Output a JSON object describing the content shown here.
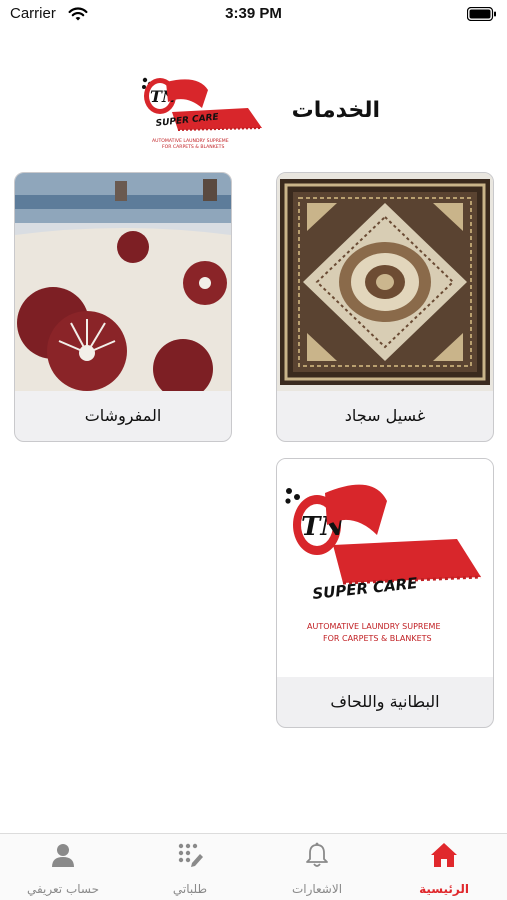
{
  "status_bar": {
    "carrier": "Carrier",
    "time": "3:39 PM"
  },
  "header": {
    "title": "الخدمات",
    "logo_icon": "tn-super-care-logo"
  },
  "services": [
    {
      "label": "غسيل سجاد",
      "image": "persian-carpet"
    },
    {
      "label": "المفروشات",
      "image": "floral-rug-cleaning"
    },
    {
      "label": "البطانية واللحاف",
      "image": "tn-super-care-logo"
    }
  ],
  "logo": {
    "brand_text": "SUPER CARE",
    "tagline_1": "AUTOMATIVE LAUNDRY SUPREME",
    "tagline_2": "FOR CARPETS & BLANKETS"
  },
  "tabs": [
    {
      "label": "الرئيسية",
      "icon": "home-icon",
      "active": true
    },
    {
      "label": "الاشعارات",
      "icon": "bell-icon",
      "active": false
    },
    {
      "label": "طلباتي",
      "icon": "orders-icon",
      "active": false
    },
    {
      "label": "حساب تعريفي",
      "icon": "profile-icon",
      "active": false
    }
  ],
  "colors": {
    "accent": "#e0282c",
    "card_bg": "#f0f0f2",
    "inactive_tab": "#8a8a8a"
  }
}
